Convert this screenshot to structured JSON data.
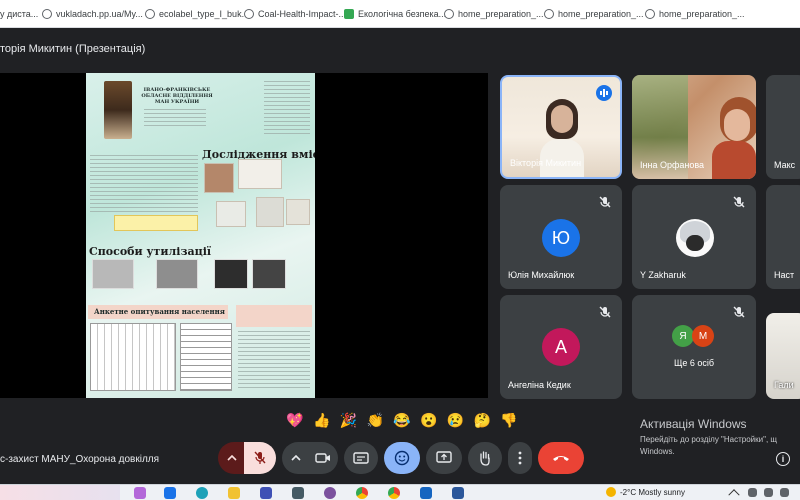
{
  "bookmarks": [
    {
      "label": "у диста...",
      "icon": "globe-icon"
    },
    {
      "label": "vukladach.pp.ua/My...",
      "icon": "globe-icon"
    },
    {
      "label": "ecolabel_type_I_buk...",
      "icon": "globe-icon"
    },
    {
      "label": "Coal-Health-Impact-...",
      "icon": "globe-icon"
    },
    {
      "label": "Екологічна безпека...",
      "icon": "green-doc-icon"
    },
    {
      "label": "home_preparation_...",
      "icon": "globe-icon"
    },
    {
      "label": "home_preparation_...",
      "icon": "globe-icon"
    },
    {
      "label": "home_preparation_...",
      "icon": "globe-icon"
    }
  ],
  "presentation_title": "торія Микитин (Презентація)",
  "poster": {
    "heading1": "ІВАНО-ФРАНКІВСЬКЕ ОБЛАСНЕ ВІДДІЛЕННЯ МАН УКРАЇНИ",
    "section_research": "Дослідження вмісту",
    "section_disposal": "Способи утилізації",
    "section_survey": "Анкетне опитування населення"
  },
  "participants": [
    {
      "name": "Вікторія Микитин",
      "speaking": true
    },
    {
      "name": "Інна Орфанова"
    },
    {
      "name": "Макс"
    },
    {
      "name": "Юлія Михайлюк",
      "initial": "Ю",
      "color": "#1a73e8",
      "muted": true
    },
    {
      "name": "Y Zakharuk",
      "muted": true
    },
    {
      "name": "Наст"
    },
    {
      "name": "Ангеліна Кедик",
      "initial": "А",
      "color": "#c2185b",
      "muted": true
    },
    {
      "name": "Ще 6 осіб",
      "initials": [
        "Я",
        "М"
      ],
      "muted": true
    },
    {
      "name": "Гали"
    }
  ],
  "reactions": [
    "💖",
    "👍",
    "🎉",
    "👏",
    "😂",
    "😮",
    "😢",
    "🤔",
    "👎"
  ],
  "meeting_name": "с-захист МАНУ_Охорона довкілля",
  "activation": {
    "title": "Активація Windows",
    "line1": "Перейдіть до розділу \"Настройки\", щ",
    "line2": "Windows."
  },
  "taskbar": {
    "weather": "-2°C  Mostly sunny"
  },
  "colors": {
    "end_call": "#ea4335",
    "active_control": "#8ab4f8",
    "mic_off_bg": "#f9dedc",
    "speaking_border": "#8ab4f8"
  }
}
